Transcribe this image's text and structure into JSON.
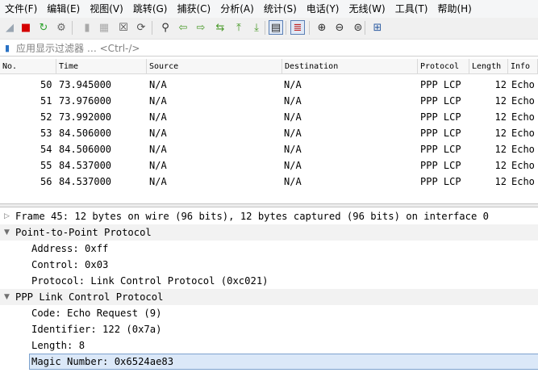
{
  "menu": [
    "文件(F)",
    "编辑(E)",
    "视图(V)",
    "跳转(G)",
    "捕获(C)",
    "分析(A)",
    "统计(S)",
    "电话(Y)",
    "无线(W)",
    "工具(T)",
    "帮助(H)"
  ],
  "toolbar": {
    "buttons": [
      {
        "name": "shark-fin-start-icon",
        "glyph": "◢",
        "color": "#9aa6b2"
      },
      {
        "name": "stop-capture-icon",
        "glyph": "■",
        "color": "#d40000"
      },
      {
        "name": "restart-capture-icon",
        "glyph": "↻",
        "color": "#2fa32f"
      },
      {
        "name": "capture-options-icon",
        "glyph": "⚙",
        "color": "#6a6a6a"
      },
      {
        "name": "open-file-icon",
        "glyph": "▮",
        "color": "#a9a9a9"
      },
      {
        "name": "save-file-icon",
        "glyph": "▦",
        "color": "#a9a9a9"
      },
      {
        "name": "close-file-icon",
        "glyph": "☒",
        "color": "#4f4f4f"
      },
      {
        "name": "reload-file-icon",
        "glyph": "⟳",
        "color": "#4f4f4f"
      },
      {
        "name": "find-packet-icon",
        "glyph": "⚲",
        "color": "#2a2a2a"
      },
      {
        "name": "go-back-icon",
        "glyph": "⇦",
        "color": "#4a9a2a"
      },
      {
        "name": "go-forward-icon",
        "glyph": "⇨",
        "color": "#4a9a2a"
      },
      {
        "name": "go-to-packet-icon",
        "glyph": "⇆",
        "color": "#4a9a2a"
      },
      {
        "name": "go-first-packet-icon",
        "glyph": "⤒",
        "color": "#4a9a2a"
      },
      {
        "name": "go-last-packet-icon",
        "glyph": "⤓",
        "color": "#4a9a2a"
      },
      {
        "name": "autoscroll-icon",
        "glyph": "▤",
        "color": "#2a2a2a"
      },
      {
        "name": "colorize-icon",
        "glyph": "≣",
        "color": "#c02020"
      },
      {
        "name": "zoom-in-icon",
        "glyph": "⊕",
        "color": "#2a2a2a"
      },
      {
        "name": "zoom-out-icon",
        "glyph": "⊖",
        "color": "#2a2a2a"
      },
      {
        "name": "normal-size-icon",
        "glyph": "⊜",
        "color": "#2a2a2a"
      },
      {
        "name": "resize-columns-icon",
        "glyph": "⊞",
        "color": "#2a5aa0"
      }
    ]
  },
  "filter": {
    "placeholder": "应用显示过滤器 … <Ctrl-/>"
  },
  "packet_list": {
    "columns": [
      "No.",
      "Time",
      "Source",
      "Destination",
      "Protocol",
      "Length",
      "Info"
    ],
    "rows": [
      {
        "no": "50",
        "time": "73.945000",
        "source": "N/A",
        "destination": "N/A",
        "protocol": "PPP LCP",
        "length": "12",
        "info": "Echo"
      },
      {
        "no": "51",
        "time": "73.976000",
        "source": "N/A",
        "destination": "N/A",
        "protocol": "PPP LCP",
        "length": "12",
        "info": "Echo"
      },
      {
        "no": "52",
        "time": "73.992000",
        "source": "N/A",
        "destination": "N/A",
        "protocol": "PPP LCP",
        "length": "12",
        "info": "Echo"
      },
      {
        "no": "53",
        "time": "84.506000",
        "source": "N/A",
        "destination": "N/A",
        "protocol": "PPP LCP",
        "length": "12",
        "info": "Echo"
      },
      {
        "no": "54",
        "time": "84.506000",
        "source": "N/A",
        "destination": "N/A",
        "protocol": "PPP LCP",
        "length": "12",
        "info": "Echo"
      },
      {
        "no": "55",
        "time": "84.537000",
        "source": "N/A",
        "destination": "N/A",
        "protocol": "PPP LCP",
        "length": "12",
        "info": "Echo"
      },
      {
        "no": "56",
        "time": "84.537000",
        "source": "N/A",
        "destination": "N/A",
        "protocol": "PPP LCP",
        "length": "12",
        "info": "Echo"
      }
    ]
  },
  "details": {
    "rows": [
      {
        "level": 0,
        "expander": "collapsed",
        "text": "Frame 45: 12 bytes on wire (96 bits), 12 bytes captured (96 bits) on interface 0"
      },
      {
        "level": 0,
        "expander": "expanded",
        "text": "Point-to-Point Protocol"
      },
      {
        "level": 1,
        "expander": "none",
        "text": "Address: 0xff"
      },
      {
        "level": 1,
        "expander": "none",
        "text": "Control: 0x03"
      },
      {
        "level": 1,
        "expander": "none",
        "text": "Protocol: Link Control Protocol (0xc021)"
      },
      {
        "level": 0,
        "expander": "expanded",
        "text": "PPP Link Control Protocol"
      },
      {
        "level": 1,
        "expander": "none",
        "text": "Code: Echo Request (9)"
      },
      {
        "level": 1,
        "expander": "none",
        "text": "Identifier: 122 (0x7a)"
      },
      {
        "level": 1,
        "expander": "none",
        "text": "Length: 8"
      },
      {
        "level": 1,
        "expander": "none",
        "text": "Magic Number: 0x6524ae83",
        "selected": true
      }
    ]
  }
}
